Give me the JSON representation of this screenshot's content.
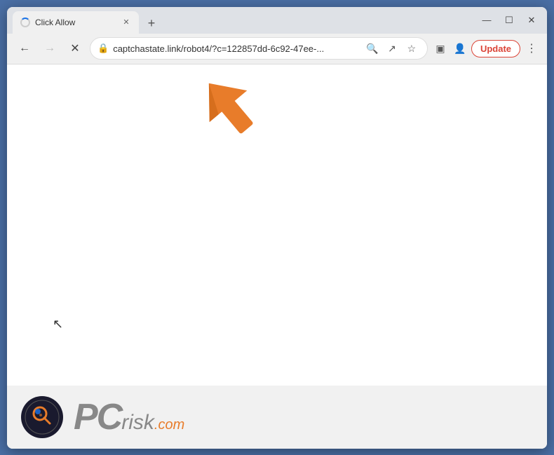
{
  "window": {
    "title": "Click Allow",
    "controls": {
      "minimize": "—",
      "maximize": "☐",
      "close": "✕"
    }
  },
  "tab": {
    "title": "Click Allow",
    "close_label": "✕",
    "new_tab_label": "+"
  },
  "navbar": {
    "back_label": "←",
    "forward_label": "→",
    "reload_label": "✕",
    "address": "captchastate.link/robot4/?c=122857dd-6c92-47ee-...",
    "search_label": "🔍",
    "share_label": "↗",
    "bookmark_label": "☆",
    "sidebar_label": "▣",
    "profile_label": "👤",
    "update_label": "Update",
    "menu_label": "⋮"
  },
  "watermark": {
    "pc_text": "PC",
    "risk_text": "risk",
    "dotcom_text": ".com"
  }
}
